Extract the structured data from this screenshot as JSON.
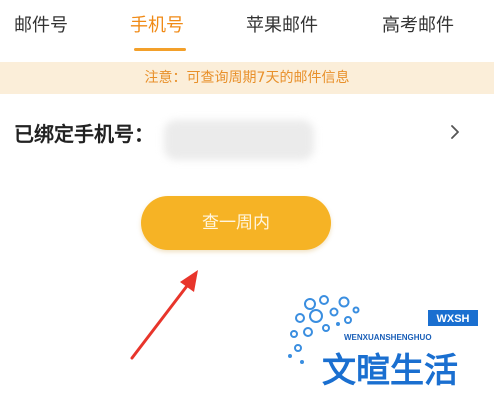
{
  "tabs": [
    {
      "label": "邮件号",
      "active": false
    },
    {
      "label": "手机号",
      "active": true
    },
    {
      "label": "苹果邮件",
      "active": false
    },
    {
      "label": "高考邮件",
      "active": false
    }
  ],
  "notice": {
    "text": "注意：可查询周期7天的邮件信息"
  },
  "phone_row": {
    "label": "已绑定手机号：",
    "value": ""
  },
  "query_button": {
    "label": "查一周内"
  },
  "watermark": {
    "pinyin": "WENXUANSHENGHUO",
    "initials": "WXSH",
    "chinese": "文暄生活"
  },
  "colors": {
    "accent": "#f08a16",
    "button": "#f6b325",
    "notice_bg": "#fbeed9",
    "arrow": "#e8352b"
  },
  "icons": [
    "chevron-right-icon",
    "red-arrow-annotation",
    "watermark-logo"
  ]
}
